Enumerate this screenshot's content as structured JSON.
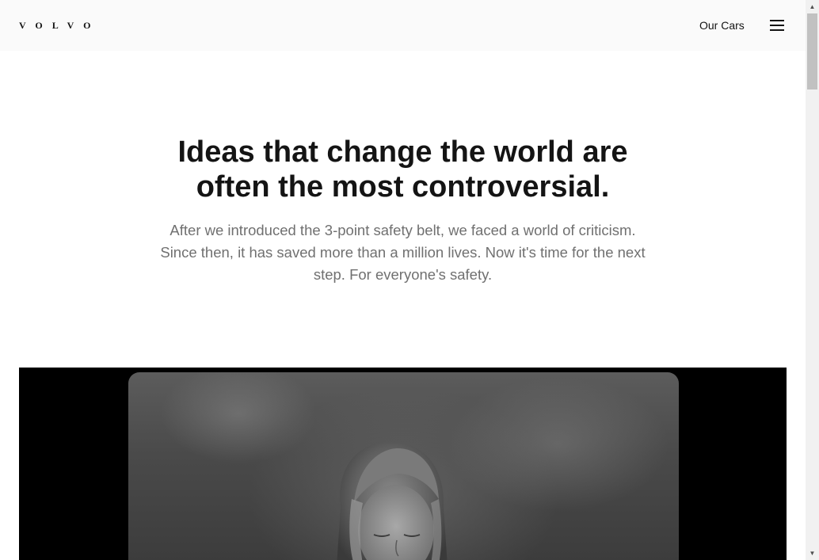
{
  "header": {
    "logo_text": "VOLVO",
    "nav_link": "Our Cars",
    "menu_icon": "hamburger-menu-icon"
  },
  "hero": {
    "title": "Ideas that change the world are often the most controversial.",
    "description": "After we introduced the 3-point safety belt, we faced a world of criticism. Since then, it has saved more than a million lives. Now it's time for the next step. For everyone's safety."
  },
  "media": {
    "kind": "black-and-white photo of a girl looking down"
  },
  "scrollbar": {
    "up_icon": "▲",
    "down_icon": "▼"
  },
  "colors": {
    "text_primary": "#141414",
    "text_secondary": "#707070",
    "header_bg": "#fafafa",
    "media_bg": "#000000"
  }
}
